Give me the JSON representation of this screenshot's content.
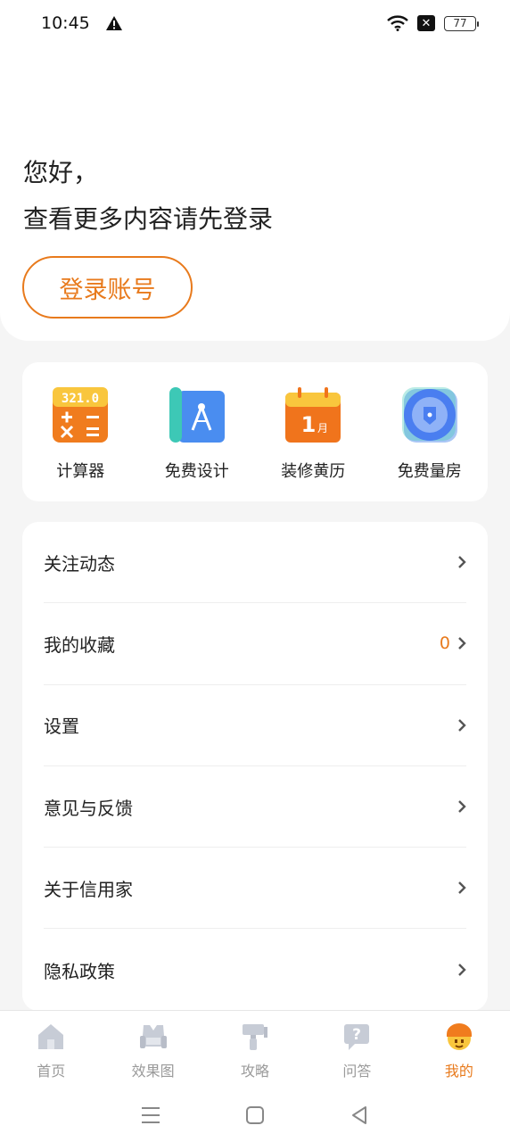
{
  "status_bar": {
    "time": "10:45",
    "battery": "77",
    "warning_icon": "warning-icon",
    "wifi_icon": "wifi-icon"
  },
  "header": {
    "greeting": "您好，",
    "prompt": "查看更多内容请先登录",
    "login_label": "登录账号"
  },
  "tools": [
    {
      "label": "计算器",
      "icon": "calculator-icon"
    },
    {
      "label": "免费设计",
      "icon": "design-icon"
    },
    {
      "label": "装修黄历",
      "icon": "calendar-icon"
    },
    {
      "label": "免费量房",
      "icon": "measure-icon"
    }
  ],
  "menu": [
    {
      "label": "关注动态"
    },
    {
      "label": "我的收藏",
      "count": "0"
    },
    {
      "label": "设置"
    },
    {
      "label": "意见与反馈"
    },
    {
      "label": "关于信用家"
    },
    {
      "label": "隐私政策"
    }
  ],
  "tabs": [
    {
      "label": "首页",
      "icon": "home-icon"
    },
    {
      "label": "效果图",
      "icon": "sofa-icon"
    },
    {
      "label": "攻略",
      "icon": "paint-roller-icon"
    },
    {
      "label": "问答",
      "icon": "question-icon"
    },
    {
      "label": "我的",
      "icon": "profile-icon",
      "active": true
    }
  ],
  "colors": {
    "accent": "#e87a1c",
    "inactive": "#9a9a9a"
  }
}
